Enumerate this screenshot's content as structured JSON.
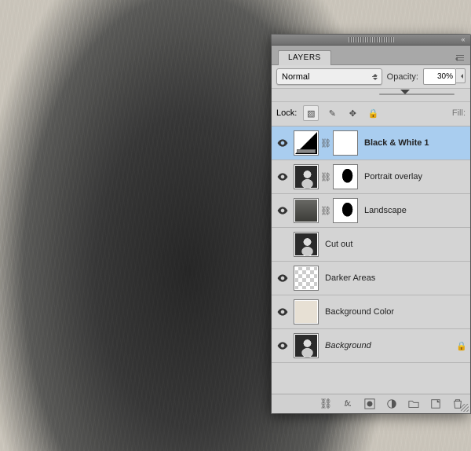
{
  "panel": {
    "tab": "LAYERS",
    "blend_mode": "Normal",
    "opacity_label": "Opacity:",
    "opacity_value": "30%",
    "lock_label": "Lock:",
    "fill_label": "Fill:"
  },
  "layers": [
    {
      "name": "Black & White 1",
      "visible": true,
      "type": "adjustment",
      "selected": true,
      "has_mask": true,
      "linked": true
    },
    {
      "name": "Portrait overlay",
      "visible": true,
      "type": "portrait",
      "has_mask": true,
      "linked": true
    },
    {
      "name": "Landscape",
      "visible": true,
      "type": "landscape",
      "has_mask": true,
      "linked": true
    },
    {
      "name": "Cut out",
      "visible": false,
      "type": "portrait"
    },
    {
      "name": "Darker Areas",
      "visible": true,
      "type": "checker"
    },
    {
      "name": "Background Color",
      "visible": true,
      "type": "solid"
    },
    {
      "name": "Background",
      "visible": true,
      "type": "portrait",
      "italic": true,
      "locked": true
    }
  ],
  "icons": {
    "lockpix": "▧",
    "brush": "✎",
    "move": "✥",
    "lock": "🔒",
    "link": "⧉",
    "fx": "fx.",
    "mask": "◑",
    "adjust": "◐",
    "group": "▭",
    "new": "▤",
    "trash": "🗑"
  }
}
